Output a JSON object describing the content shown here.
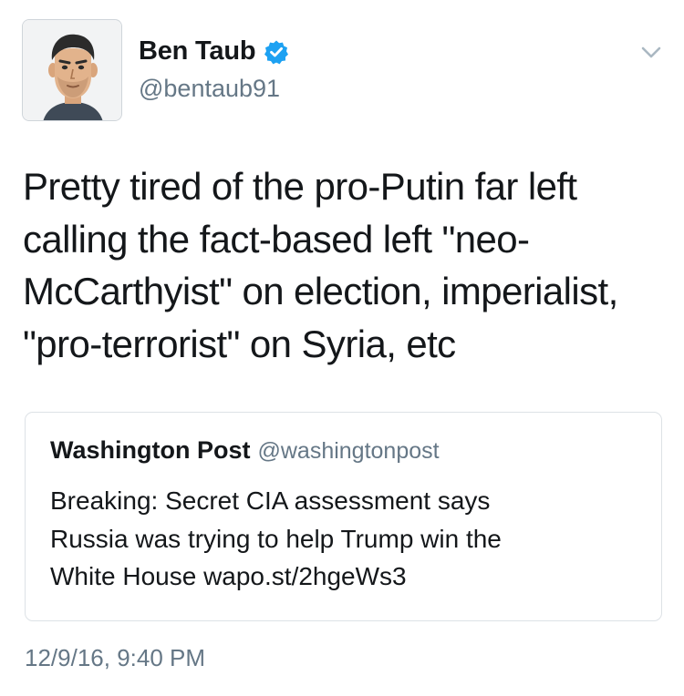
{
  "author": {
    "display_name": "Ben Taub",
    "handle": "@bentaub91",
    "verified_icon": "verified-badge-icon",
    "avatar_icon": "cartoon-avatar"
  },
  "menu_icon": "chevron-down-icon",
  "tweet": {
    "lines": [
      "Pretty tired of the pro-Putin far left",
      "calling the fact-based left \"neo-",
      "McCarthyist\" on election, imperialist,",
      "\"pro-terrorist\" on Syria, etc"
    ]
  },
  "quoted_tweet": {
    "author_name": "Washington Post",
    "author_handle": "@washingtonpost",
    "lines": [
      "Breaking: Secret CIA assessment says",
      "Russia was trying to help Trump win the",
      "White House wapo.st/2hgeWs3"
    ]
  },
  "timestamp": "12/9/16, 9:40 PM",
  "colors": {
    "text": "#14171a",
    "secondary_text": "#657786",
    "verified_blue": "#1da1f2",
    "border": "#dde2e6"
  }
}
